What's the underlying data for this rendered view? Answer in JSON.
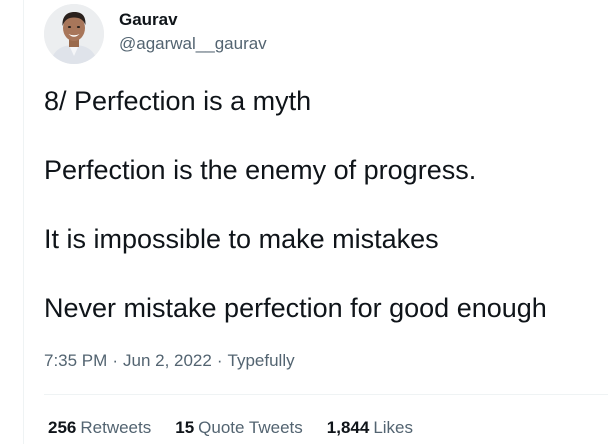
{
  "author": {
    "display_name": "Gaurav",
    "handle": "@agarwal__gaurav"
  },
  "tweet": {
    "paragraphs": [
      "8/ Perfection is a myth",
      "Perfection is the enemy of progress.",
      "It is impossible to make mistakes",
      "Never mistake perfection for good enough"
    ],
    "time": "7:35 PM",
    "date": "Jun 2, 2022",
    "source": "Typefully",
    "separator": "·"
  },
  "stats": {
    "retweets": {
      "count": "256",
      "label": "Retweets"
    },
    "quote_tweets": {
      "count": "15",
      "label": "Quote Tweets"
    },
    "likes": {
      "count": "1,844",
      "label": "Likes"
    }
  },
  "colors": {
    "text_primary": "#0f1419",
    "text_secondary": "#536471",
    "border": "#eff3f4"
  }
}
